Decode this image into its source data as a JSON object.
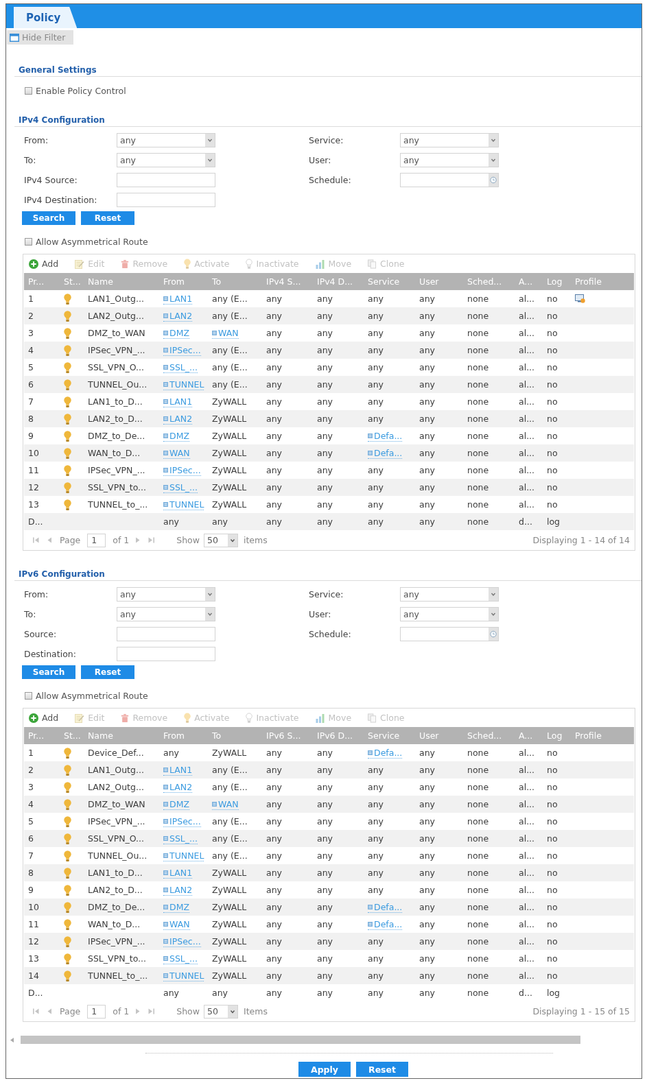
{
  "tabs": [
    {
      "label": "Policy",
      "selected": true
    }
  ],
  "hide_filter": {
    "label": "Hide Filter"
  },
  "general_settings": {
    "title": "General Settings",
    "options": [
      {
        "label": "Enable Policy Control",
        "checked": false
      }
    ]
  },
  "sections": [
    {
      "title": "IPv4 Configuration",
      "filters": [
        {
          "label": "From:",
          "kind": "select",
          "value": "any"
        },
        {
          "label": "Service:",
          "kind": "select",
          "value": "any"
        },
        {
          "label": "To:",
          "kind": "select",
          "value": "any"
        },
        {
          "label": "User:",
          "kind": "select",
          "value": "any"
        },
        {
          "label": "IPv4 Source:",
          "kind": "text"
        },
        {
          "label": "Schedule:",
          "kind": "picker"
        },
        {
          "label": "IPv4 Destination:",
          "kind": "text"
        }
      ],
      "buttons": [
        "Search",
        "Reset"
      ],
      "options": [
        {
          "label": "Allow Asymmetrical Route",
          "checked": false
        }
      ],
      "toolbar": [
        {
          "label": "Add",
          "kind": "add",
          "disabled": false
        },
        {
          "label": "Edit",
          "kind": "edit",
          "disabled": true
        },
        {
          "label": "Remove",
          "kind": "remove",
          "disabled": true
        },
        {
          "label": "Activate",
          "kind": "activate",
          "disabled": true
        },
        {
          "label": "Inactivate",
          "kind": "inactivate",
          "disabled": true
        },
        {
          "label": "Move",
          "kind": "move",
          "disabled": true
        },
        {
          "label": "Clone",
          "kind": "clone",
          "disabled": true
        }
      ],
      "table": {
        "columns": [
          {
            "label": "Pr..."
          },
          {
            "label": "St..."
          },
          {
            "label": "Name"
          },
          {
            "label": "From"
          },
          {
            "label": "To"
          },
          {
            "label": "IPv4 S..."
          },
          {
            "label": "IPv4 D..."
          },
          {
            "label": "Service"
          },
          {
            "label": "User"
          },
          {
            "label": "Sched..."
          },
          {
            "label": "A..."
          },
          {
            "label": "Log"
          },
          {
            "label": "Profile"
          }
        ],
        "rows": [
          {
            "cells": [
              "1",
              {
                "kind": "status",
                "active": true
              },
              "LAN1_Outg...",
              {
                "text": "LAN1",
                "kind": "link"
              },
              "any (E...",
              "any",
              "any",
              "any",
              "any",
              "none",
              "al...",
              "no",
              {
                "kind": "profile"
              }
            ]
          },
          {
            "cells": [
              "2",
              {
                "kind": "status",
                "active": true
              },
              "LAN2_Outg...",
              {
                "text": "LAN2",
                "kind": "link"
              },
              "any (E...",
              "any",
              "any",
              "any",
              "any",
              "none",
              "al...",
              "no",
              ""
            ]
          },
          {
            "cells": [
              "3",
              {
                "kind": "status",
                "active": true
              },
              "DMZ_to_WAN",
              {
                "text": "DMZ",
                "kind": "link"
              },
              {
                "text": "WAN",
                "kind": "link"
              },
              "any",
              "any",
              "any",
              "any",
              "none",
              "al...",
              "no",
              ""
            ]
          },
          {
            "cells": [
              "4",
              {
                "kind": "status",
                "active": true
              },
              "IPSec_VPN_...",
              {
                "text": "IPSec...",
                "kind": "link"
              },
              "any (E...",
              "any",
              "any",
              "any",
              "any",
              "none",
              "al...",
              "no",
              ""
            ]
          },
          {
            "cells": [
              "5",
              {
                "kind": "status",
                "active": true
              },
              "SSL_VPN_O...",
              {
                "text": "SSL_...",
                "kind": "link"
              },
              "any (E...",
              "any",
              "any",
              "any",
              "any",
              "none",
              "al...",
              "no",
              ""
            ]
          },
          {
            "cells": [
              "6",
              {
                "kind": "status",
                "active": true
              },
              "TUNNEL_Ou...",
              {
                "text": "TUNNEL",
                "kind": "link"
              },
              "any (E...",
              "any",
              "any",
              "any",
              "any",
              "none",
              "al...",
              "no",
              ""
            ]
          },
          {
            "cells": [
              "7",
              {
                "kind": "status",
                "active": true
              },
              "LAN1_to_D...",
              {
                "text": "LAN1",
                "kind": "link"
              },
              "ZyWALL",
              "any",
              "any",
              "any",
              "any",
              "none",
              "al...",
              "no",
              ""
            ]
          },
          {
            "cells": [
              "8",
              {
                "kind": "status",
                "active": true
              },
              "LAN2_to_D...",
              {
                "text": "LAN2",
                "kind": "link"
              },
              "ZyWALL",
              "any",
              "any",
              "any",
              "any",
              "none",
              "al...",
              "no",
              ""
            ]
          },
          {
            "cells": [
              "9",
              {
                "kind": "status",
                "active": true
              },
              "DMZ_to_De...",
              {
                "text": "DMZ",
                "kind": "link"
              },
              "ZyWALL",
              "any",
              "any",
              {
                "text": "Defa...",
                "kind": "link"
              },
              "any",
              "none",
              "al...",
              "no",
              ""
            ]
          },
          {
            "cells": [
              "10",
              {
                "kind": "status",
                "active": true
              },
              "WAN_to_D...",
              {
                "text": "WAN",
                "kind": "link"
              },
              "ZyWALL",
              "any",
              "any",
              {
                "text": "Defa...",
                "kind": "link"
              },
              "any",
              "none",
              "al...",
              "no",
              ""
            ]
          },
          {
            "cells": [
              "11",
              {
                "kind": "status",
                "active": true
              },
              "IPSec_VPN_...",
              {
                "text": "IPSec...",
                "kind": "link"
              },
              "ZyWALL",
              "any",
              "any",
              "any",
              "any",
              "none",
              "al...",
              "no",
              ""
            ]
          },
          {
            "cells": [
              "12",
              {
                "kind": "status",
                "active": true
              },
              "SSL_VPN_to...",
              {
                "text": "SSL_...",
                "kind": "link"
              },
              "ZyWALL",
              "any",
              "any",
              "any",
              "any",
              "none",
              "al...",
              "no",
              ""
            ]
          },
          {
            "cells": [
              "13",
              {
                "kind": "status",
                "active": true
              },
              "TUNNEL_to_...",
              {
                "text": "TUNNEL",
                "kind": "link"
              },
              "ZyWALL",
              "any",
              "any",
              "any",
              "any",
              "none",
              "al...",
              "no",
              ""
            ]
          },
          {
            "cells": [
              "D...",
              "",
              "",
              "any",
              "any",
              "any",
              "any",
              "any",
              "any",
              "none",
              "d...",
              "log",
              ""
            ]
          }
        ]
      },
      "pager": {
        "page_label": "Page",
        "page": "1",
        "of": "of 1",
        "show_label": "Show",
        "per_page": "50",
        "items_label": "items",
        "displaying": "Displaying 1 - 14 of 14"
      }
    },
    {
      "title": "IPv6 Configuration",
      "filters": [
        {
          "label": "From:",
          "kind": "select",
          "value": "any"
        },
        {
          "label": "Service:",
          "kind": "select",
          "value": "any"
        },
        {
          "label": "To:",
          "kind": "select",
          "value": "any"
        },
        {
          "label": "User:",
          "kind": "select",
          "value": "any"
        },
        {
          "label": "Source:",
          "kind": "text"
        },
        {
          "label": "Schedule:",
          "kind": "picker"
        },
        {
          "label": "Destination:",
          "kind": "text"
        }
      ],
      "buttons": [
        "Search",
        "Reset"
      ],
      "options": [
        {
          "label": "Allow Asymmetrical Route",
          "checked": false
        }
      ],
      "toolbar": [
        {
          "label": "Add",
          "kind": "add",
          "disabled": false
        },
        {
          "label": "Edit",
          "kind": "edit",
          "disabled": true
        },
        {
          "label": "Remove",
          "kind": "remove",
          "disabled": true
        },
        {
          "label": "Activate",
          "kind": "activate",
          "disabled": true
        },
        {
          "label": "Inactivate",
          "kind": "inactivate",
          "disabled": true
        },
        {
          "label": "Move",
          "kind": "move",
          "disabled": true
        },
        {
          "label": "Clone",
          "kind": "clone",
          "disabled": true
        }
      ],
      "table": {
        "columns": [
          {
            "label": "Pr..."
          },
          {
            "label": "St..."
          },
          {
            "label": "Name"
          },
          {
            "label": "From"
          },
          {
            "label": "To"
          },
          {
            "label": "IPv6 S..."
          },
          {
            "label": "IPv6 D..."
          },
          {
            "label": "Service"
          },
          {
            "label": "User"
          },
          {
            "label": "Sched..."
          },
          {
            "label": "A..."
          },
          {
            "label": "Log"
          },
          {
            "label": "Profile"
          }
        ],
        "rows": [
          {
            "cells": [
              "1",
              {
                "kind": "status",
                "active": true
              },
              "Device_Def...",
              "any",
              "ZyWALL",
              "any",
              "any",
              {
                "text": "Defa...",
                "kind": "link"
              },
              "any",
              "none",
              "al...",
              "no",
              ""
            ]
          },
          {
            "cells": [
              "2",
              {
                "kind": "status",
                "active": true
              },
              "LAN1_Outg...",
              {
                "text": "LAN1",
                "kind": "link"
              },
              "any (E...",
              "any",
              "any",
              "any",
              "any",
              "none",
              "al...",
              "no",
              ""
            ]
          },
          {
            "cells": [
              "3",
              {
                "kind": "status",
                "active": true
              },
              "LAN2_Outg...",
              {
                "text": "LAN2",
                "kind": "link"
              },
              "any (E...",
              "any",
              "any",
              "any",
              "any",
              "none",
              "al...",
              "no",
              ""
            ]
          },
          {
            "cells": [
              "4",
              {
                "kind": "status",
                "active": true
              },
              "DMZ_to_WAN",
              {
                "text": "DMZ",
                "kind": "link"
              },
              {
                "text": "WAN",
                "kind": "link"
              },
              "any",
              "any",
              "any",
              "any",
              "none",
              "al...",
              "no",
              ""
            ]
          },
          {
            "cells": [
              "5",
              {
                "kind": "status",
                "active": true
              },
              "IPSec_VPN_...",
              {
                "text": "IPSec...",
                "kind": "link"
              },
              "any (E...",
              "any",
              "any",
              "any",
              "any",
              "none",
              "al...",
              "no",
              ""
            ]
          },
          {
            "cells": [
              "6",
              {
                "kind": "status",
                "active": true
              },
              "SSL_VPN_O...",
              {
                "text": "SSL_...",
                "kind": "link"
              },
              "any (E...",
              "any",
              "any",
              "any",
              "any",
              "none",
              "al...",
              "no",
              ""
            ]
          },
          {
            "cells": [
              "7",
              {
                "kind": "status",
                "active": true
              },
              "TUNNEL_Ou...",
              {
                "text": "TUNNEL",
                "kind": "link"
              },
              "any (E...",
              "any",
              "any",
              "any",
              "any",
              "none",
              "al...",
              "no",
              ""
            ]
          },
          {
            "cells": [
              "8",
              {
                "kind": "status",
                "active": true
              },
              "LAN1_to_D...",
              {
                "text": "LAN1",
                "kind": "link"
              },
              "ZyWALL",
              "any",
              "any",
              "any",
              "any",
              "none",
              "al...",
              "no",
              ""
            ]
          },
          {
            "cells": [
              "9",
              {
                "kind": "status",
                "active": true
              },
              "LAN2_to_D...",
              {
                "text": "LAN2",
                "kind": "link"
              },
              "ZyWALL",
              "any",
              "any",
              "any",
              "any",
              "none",
              "al...",
              "no",
              ""
            ]
          },
          {
            "cells": [
              "10",
              {
                "kind": "status",
                "active": true
              },
              "DMZ_to_De...",
              {
                "text": "DMZ",
                "kind": "link"
              },
              "ZyWALL",
              "any",
              "any",
              {
                "text": "Defa...",
                "kind": "link"
              },
              "any",
              "none",
              "al...",
              "no",
              ""
            ]
          },
          {
            "cells": [
              "11",
              {
                "kind": "status",
                "active": true
              },
              "WAN_to_D...",
              {
                "text": "WAN",
                "kind": "link"
              },
              "ZyWALL",
              "any",
              "any",
              {
                "text": "Defa...",
                "kind": "link"
              },
              "any",
              "none",
              "al...",
              "no",
              ""
            ]
          },
          {
            "cells": [
              "12",
              {
                "kind": "status",
                "active": true
              },
              "IPSec_VPN_...",
              {
                "text": "IPSec...",
                "kind": "link"
              },
              "ZyWALL",
              "any",
              "any",
              "any",
              "any",
              "none",
              "al...",
              "no",
              ""
            ]
          },
          {
            "cells": [
              "13",
              {
                "kind": "status",
                "active": true
              },
              "SSL_VPN_to...",
              {
                "text": "SSL_...",
                "kind": "link"
              },
              "ZyWALL",
              "any",
              "any",
              "any",
              "any",
              "none",
              "al...",
              "no",
              ""
            ]
          },
          {
            "cells": [
              "14",
              {
                "kind": "status",
                "active": true
              },
              "TUNNEL_to_...",
              {
                "text": "TUNNEL",
                "kind": "link"
              },
              "ZyWALL",
              "any",
              "any",
              "any",
              "any",
              "none",
              "al...",
              "no",
              ""
            ]
          },
          {
            "cells": [
              "D...",
              "",
              "",
              "any",
              "any",
              "any",
              "any",
              "any",
              "any",
              "none",
              "d...",
              "log",
              ""
            ]
          }
        ]
      },
      "pager": {
        "page_label": "Page",
        "page": "1",
        "of": "of 1",
        "show_label": "Show",
        "per_page": "50",
        "items_label": "Items",
        "displaying": "Displaying 1 - 15 of 15"
      }
    }
  ],
  "footer_buttons": [
    "Apply",
    "Reset"
  ]
}
